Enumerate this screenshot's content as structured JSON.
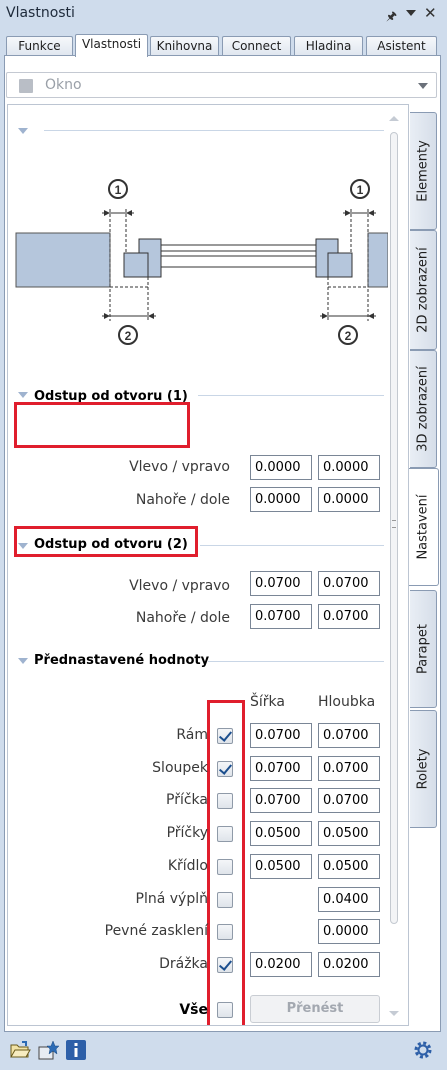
{
  "window": {
    "title": "Vlastnosti"
  },
  "tabs": [
    "Funkce",
    "Vlastnosti",
    "Knihovna",
    "Connect",
    "Hladina",
    "Asistent"
  ],
  "active_tab": "Vlastnosti",
  "object_select": {
    "value": "Okno"
  },
  "side_tabs": [
    "Elementy",
    "2D zobrazení",
    "3D zobrazení",
    "Nastavení",
    "Parapet",
    "Rolety"
  ],
  "active_side_tab": "Nastavení",
  "diagram": {
    "marker_1": "1",
    "marker_2": "2"
  },
  "section1": {
    "title": "Odstup od otvoru (1)",
    "row1": {
      "label": "Vlevo / vpravo",
      "left": "0.0000",
      "right": "0.0000"
    },
    "row2": {
      "label": "Nahoře / dole",
      "left": "0.0000",
      "right": "0.0000"
    }
  },
  "section2": {
    "title": "Odstup od otvoru (2)",
    "row1": {
      "label": "Vlevo / vpravo",
      "left": "0.0700",
      "right": "0.0700"
    },
    "row2": {
      "label": "Nahoře / dole",
      "left": "0.0700",
      "right": "0.0700"
    }
  },
  "presets": {
    "title": "Přednastavené hodnoty",
    "col_width": "Šířka",
    "col_depth": "Hloubka",
    "rows": [
      {
        "label": "Rám",
        "checked": true,
        "width": "0.0700",
        "depth": "0.0700"
      },
      {
        "label": "Sloupek",
        "checked": true,
        "width": "0.0700",
        "depth": "0.0700"
      },
      {
        "label": "Příčka",
        "checked": false,
        "width": "0.0700",
        "depth": "0.0700"
      },
      {
        "label": "Příčky",
        "checked": false,
        "width": "0.0500",
        "depth": "0.0500"
      },
      {
        "label": "Křídlo",
        "checked": false,
        "width": "0.0500",
        "depth": "0.0500"
      },
      {
        "label": "Plná výplň",
        "checked": false,
        "width": "",
        "depth": "0.0400"
      },
      {
        "label": "Pevné zasklení",
        "checked": false,
        "width": "",
        "depth": "0.0000"
      },
      {
        "label": "Drážka",
        "checked": true,
        "width": "0.0200",
        "depth": "0.0200"
      }
    ],
    "all_label": "Vše",
    "all_checked": false,
    "transfer_button": "Přenést"
  },
  "highlight_color": "#e01e2d",
  "bottom_icons": [
    "open-folder-icon",
    "favorites-icon",
    "info-icon",
    "settings-gear-icon"
  ]
}
